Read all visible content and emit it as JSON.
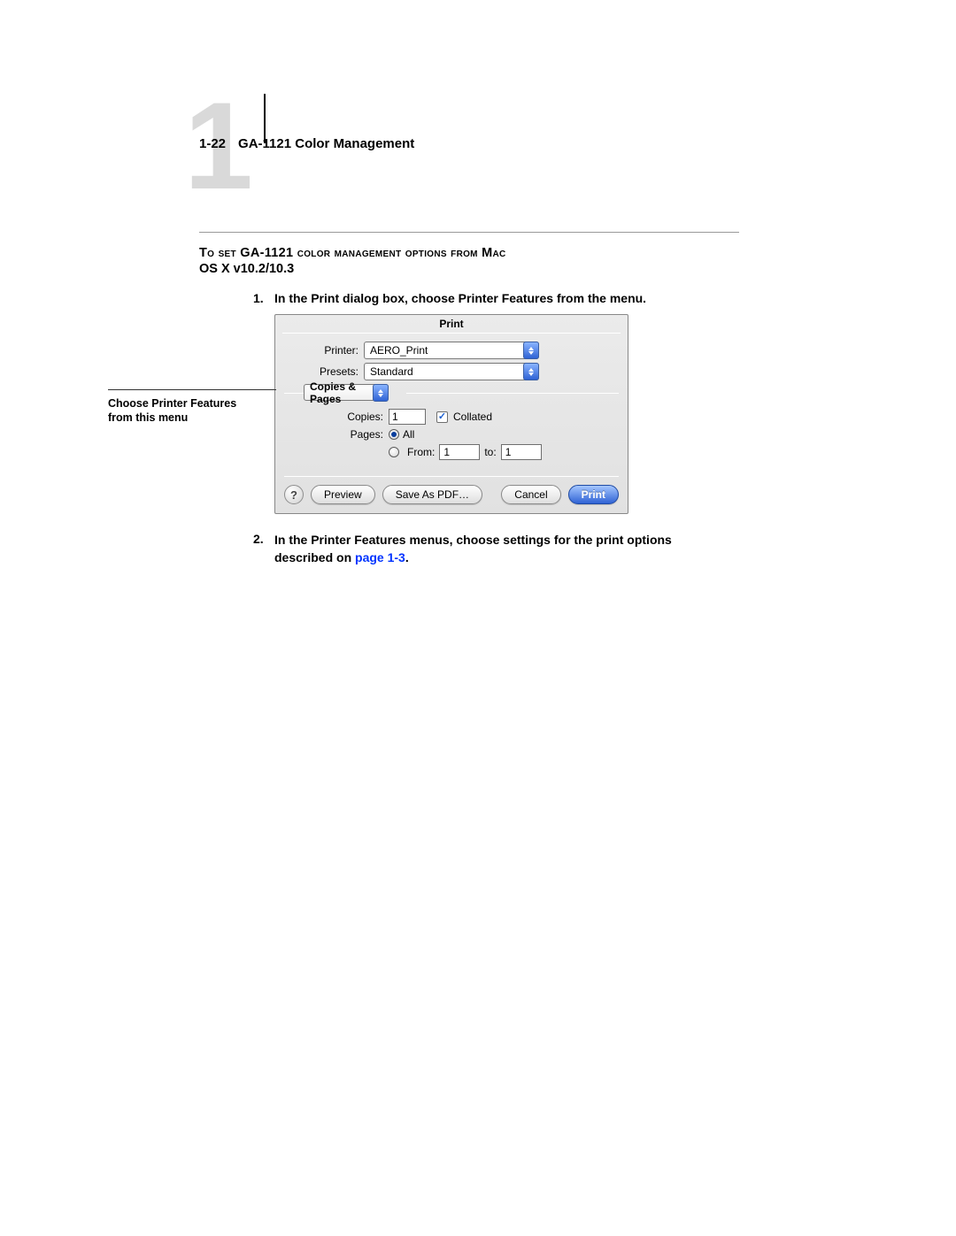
{
  "header": {
    "chapter_number": "1",
    "page_ref": "1-22",
    "doc_title": "GA-1121 Color Management"
  },
  "section": {
    "title": "To set GA-1121 color management options from Mac",
    "subtitle": "OS X v10.2/10.3"
  },
  "steps": {
    "s1_num": "1.",
    "s1_text": "In the Print dialog box, choose Printer Features from the menu.",
    "s2_num": "2.",
    "s2_text_a": "In the Printer Features menus, choose settings for the print options described on ",
    "s2_link": "page 1-3",
    "s2_text_b": "."
  },
  "callout": {
    "line1": "Choose Printer Features",
    "line2": "from this menu"
  },
  "dialog": {
    "title": "Print",
    "printer_label": "Printer:",
    "printer_value": "AERO_Print",
    "presets_label": "Presets:",
    "presets_value": "Standard",
    "section_menu": "Copies & Pages",
    "copies_label": "Copies:",
    "copies_value": "1",
    "collated_label": "Collated",
    "pages_label": "Pages:",
    "pages_all": "All",
    "pages_from": "From:",
    "pages_from_value": "1",
    "pages_to": "to:",
    "pages_to_value": "1",
    "help": "?",
    "preview_btn": "Preview",
    "savepdf_btn": "Save As PDF…",
    "cancel_btn": "Cancel",
    "print_btn": "Print"
  }
}
